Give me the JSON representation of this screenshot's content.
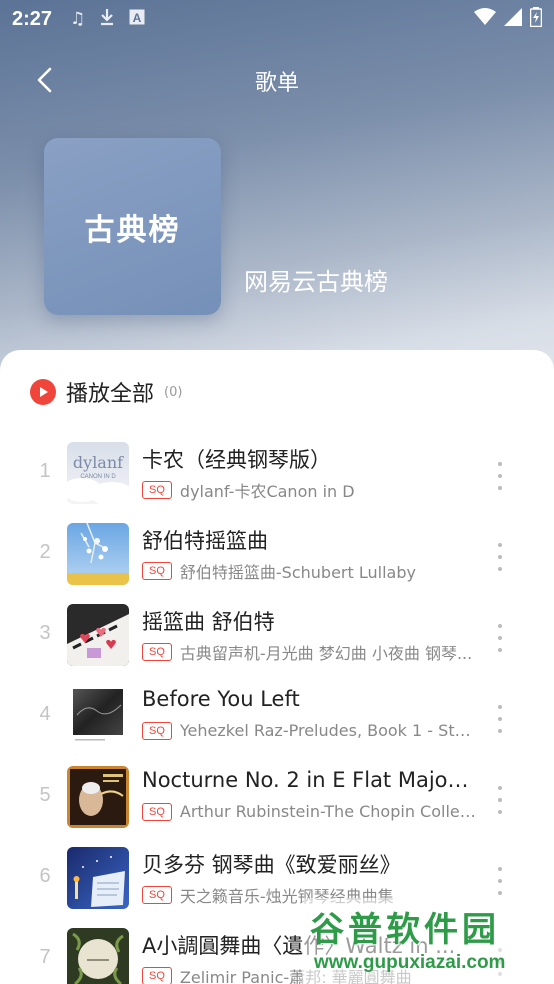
{
  "status_bar": {
    "time": "2:27",
    "left_icons": [
      "music-note-icon",
      "download-icon",
      "a-icon"
    ],
    "right_icons": [
      "wifi-icon",
      "cellular-icon",
      "battery-icon"
    ]
  },
  "nav": {
    "title": "歌单",
    "back_icon": "chevron-left-icon"
  },
  "playlist": {
    "cover_text": "古典榜",
    "name": "网易云古典榜"
  },
  "play_all": {
    "label": "播放全部",
    "count": "(0)"
  },
  "songs": [
    {
      "index": "1",
      "title": "卡农（经典钢琴版）",
      "quality": "SQ",
      "subtitle": "dylanf-卡农Canon in D"
    },
    {
      "index": "2",
      "title": "舒伯特摇篮曲",
      "quality": "SQ",
      "subtitle": "舒伯特摇篮曲-Schubert Lullaby"
    },
    {
      "index": "3",
      "title": "摇篮曲 舒伯特",
      "quality": "SQ",
      "subtitle": "古典留声机-月光曲 梦幻曲 小夜曲 钢琴..."
    },
    {
      "index": "4",
      "title": "Before You Left",
      "quality": "SQ",
      "subtitle": "Yehezkel Raz-Preludes, Book 1 - Stre..."
    },
    {
      "index": "5",
      "title": "Nocturne No. 2 in E Flat Major, ...",
      "quality": "SQ",
      "subtitle": "Arthur Rubinstein-The Chopin Collect..."
    },
    {
      "index": "6",
      "title": "贝多芬 钢琴曲《致爱丽丝》",
      "quality": "SQ",
      "subtitle": "天之籁音乐-烛光钢琴经典曲集"
    },
    {
      "index": "7",
      "title": "A小調圓舞曲〈遺作〉Waltz in ...",
      "quality": "SQ",
      "subtitle": "Zelimir Panic-蕭邦: 華麗圓舞曲"
    }
  ],
  "album_art_labels": {
    "song1": "dylanf",
    "song1_sub": "CANON IN D"
  },
  "watermark": {
    "brand": "谷普软件园",
    "url": "www.gupuxiazai.com"
  },
  "colors": {
    "accent": "#f0453a",
    "header_top": "#5b7396",
    "cover": "#7590b8",
    "watermark": "#2e9b48"
  }
}
